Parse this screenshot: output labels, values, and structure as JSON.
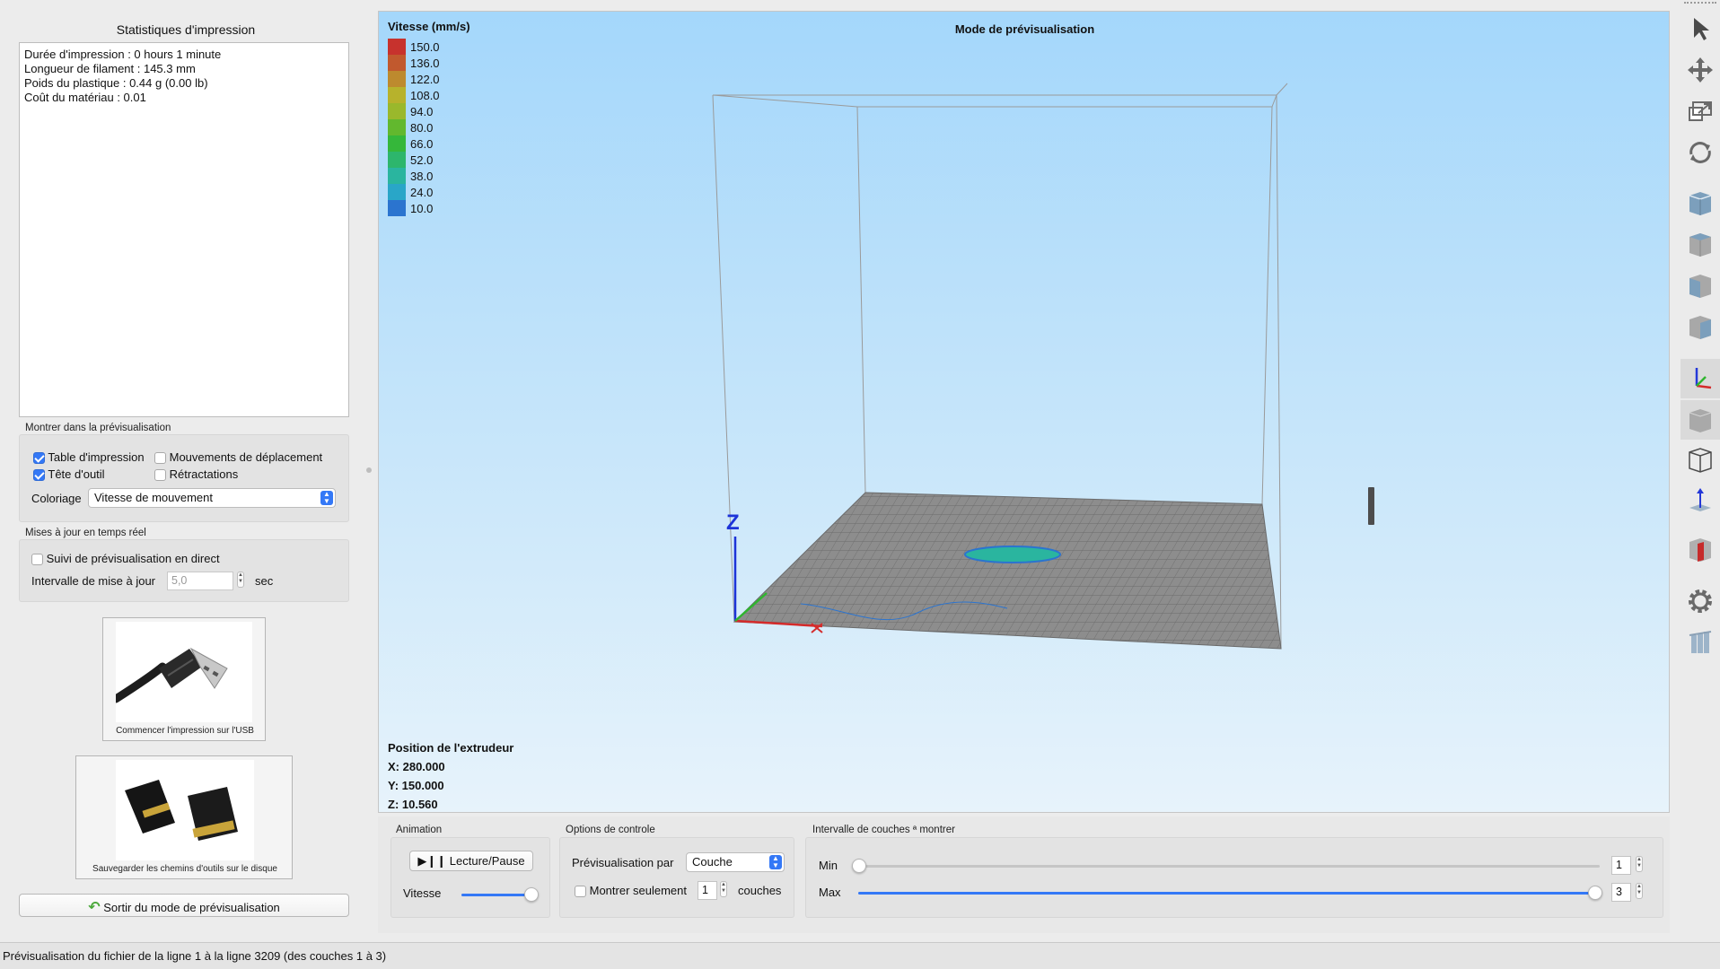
{
  "stats": {
    "title": "Statistiques d'impression",
    "lines": [
      "Durée d'impression : 0 hours 1 minute",
      "Longueur de filament : 145.3 mm",
      "Poids du plastique : 0.44 g (0.00 lb)",
      "Coût du matériau : 0.01"
    ]
  },
  "show_group": {
    "label": "Montrer dans la prévisualisation",
    "table": {
      "label": "Table d'impression",
      "checked": true
    },
    "toolhead": {
      "label": "Tête d'outil",
      "checked": true
    },
    "travel": {
      "label": "Mouvements de déplacement",
      "checked": false
    },
    "retract": {
      "label": "Rétractations",
      "checked": false
    },
    "coloring_label": "Coloriage",
    "coloring_value": "Vitesse de mouvement"
  },
  "live_group": {
    "label": "Mises à jour en temps réel",
    "follow_label": "Suivi de prévisualisation en direct",
    "interval_label": "Intervalle de mise à jour",
    "interval_value": "5,0",
    "interval_unit": "sec"
  },
  "usb_button": {
    "label": "Commencer l'impression sur l'USB"
  },
  "sd_button": {
    "label": "Sauvegarder les chemins d'outils sur le disque"
  },
  "exit_button": {
    "label": "Sortir du mode de prévisualisation"
  },
  "viewport": {
    "title": "Mode de prévisualisation",
    "legend_title": "Vitesse (mm/s)",
    "legend": [
      {
        "value": "150.0",
        "color": "#c7322d"
      },
      {
        "value": "136.0",
        "color": "#c1592e"
      },
      {
        "value": "122.0",
        "color": "#bd8a2e"
      },
      {
        "value": "108.0",
        "color": "#b7b22c"
      },
      {
        "value": "94.0",
        "color": "#9ab82c"
      },
      {
        "value": "80.0",
        "color": "#62b82e"
      },
      {
        "value": "66.0",
        "color": "#35b73a"
      },
      {
        "value": "52.0",
        "color": "#2db66c"
      },
      {
        "value": "38.0",
        "color": "#2ab59f"
      },
      {
        "value": "24.0",
        "color": "#29a6c8"
      },
      {
        "value": "10.0",
        "color": "#2b74cf"
      }
    ],
    "axis_label": "Z",
    "extruder_title": "Position de l'extrudeur",
    "x": "X: 280.000",
    "y": "Y: 150.000",
    "z": "Z: 10.560"
  },
  "animation": {
    "label": "Animation",
    "play_label": "Lecture/Pause",
    "speed_label": "Vitesse",
    "speed_level": 1.0
  },
  "control_options": {
    "label": "Options de controle",
    "preview_by_label": "Prévisualisation par",
    "preview_by_value": "Couche",
    "show_only_label": "Montrer seulement",
    "show_only_value": "1",
    "layers_label": "couches"
  },
  "layer_range": {
    "label": "Intervalle de couches ª montrer",
    "min_label": "Min",
    "min_value": "1",
    "max_label": "Max",
    "max_value": "3"
  },
  "status_bar": "Prévisualisation du fichier de la ligne 1 à la ligne 3209 (des couches 1 à 3)",
  "toolbar_icons": [
    "cursor-icon",
    "move-icon",
    "scale-icon",
    "rotate-icon",
    "cube-view-icon",
    "cube-view-front-icon",
    "cube-view-side-icon",
    "cube-view-top-icon",
    "axes-icon",
    "solid-view-icon",
    "wireframe-view-icon",
    "normals-icon",
    "clip-view-icon",
    "gear-icon",
    "layers-icon"
  ]
}
